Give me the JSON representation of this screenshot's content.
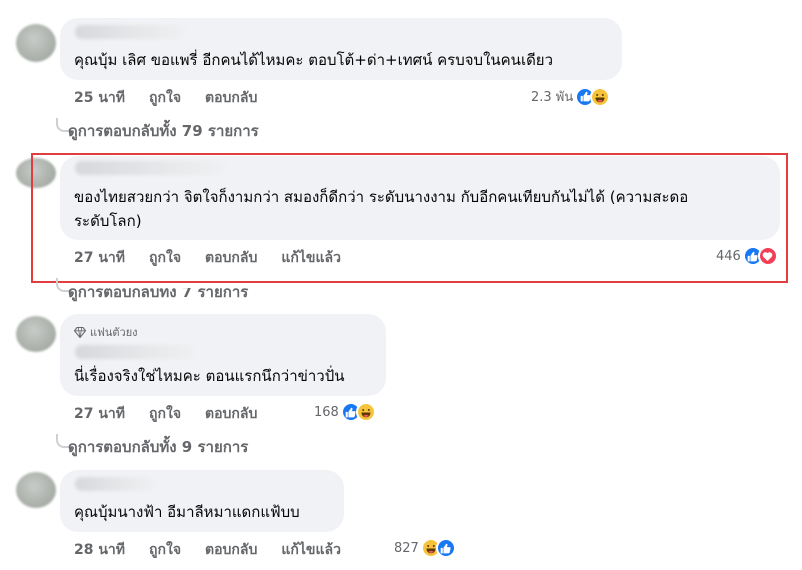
{
  "comments": [
    {
      "text_lines": [
        "คุณบุ้ม เลิศ ขอแพรี่ อีกคนได้ไหมคะ ตอบโต้+ด่า+เทศน์ ครบจบในคนเดียว"
      ],
      "time": "25 นาที",
      "like_label": "ถูกใจ",
      "reply_label": "ตอบกลับ",
      "reaction_count": "2.3 พัน",
      "reactions": [
        "like-icon",
        "haha-icon"
      ]
    },
    {
      "text_lines": [
        "ของไทยสวยกว่า จิตใจก็งามกว่า สมองก็ดีกว่า ระดับนางงาม กับอีกคนเทียบกันไม่ได้ (ความสะดอ",
        "ระดับโลก)"
      ],
      "time": "27 นาที",
      "like_label": "ถูกใจ",
      "reply_label": "ตอบกลับ",
      "edited_label": "แก้ไขแล้ว",
      "reaction_count": "446",
      "reactions": [
        "like-icon",
        "love-icon"
      ]
    },
    {
      "badge": "แฟนตัวยง",
      "text_lines": [
        "นี่เรื่องจริงใช่ไหมคะ ตอนแรกนึกว่าข่าวปั่น"
      ],
      "time": "27 นาที",
      "like_label": "ถูกใจ",
      "reply_label": "ตอบกลับ",
      "reaction_count": "168",
      "reactions": [
        "like-icon",
        "haha-icon"
      ]
    },
    {
      "text_lines": [
        "คุณบุ้มนางฟ้า อีมาลีหมาแดกแฟ้บบ"
      ],
      "time": "28 นาที",
      "like_label": "ถูกใจ",
      "reply_label": "ตอบกลับ",
      "edited_label": "แก้ไขแล้ว",
      "reaction_count": "827",
      "reactions": [
        "haha-icon",
        "like-icon"
      ]
    }
  ],
  "view_replies": [
    "ดูการตอบกลับทั้ง 79 รายการ",
    "ดูการตอบกลับทั้ง 7 รายการ",
    "ดูการตอบกลับทั้ง 9 รายการ"
  ],
  "colors": {
    "highlight_border": "#e03e3e",
    "like": "#1877f2",
    "love": "#f33e58",
    "haha": "#f7c33b",
    "bubble": "#f0f2f5",
    "secondary_text": "#65676b"
  }
}
